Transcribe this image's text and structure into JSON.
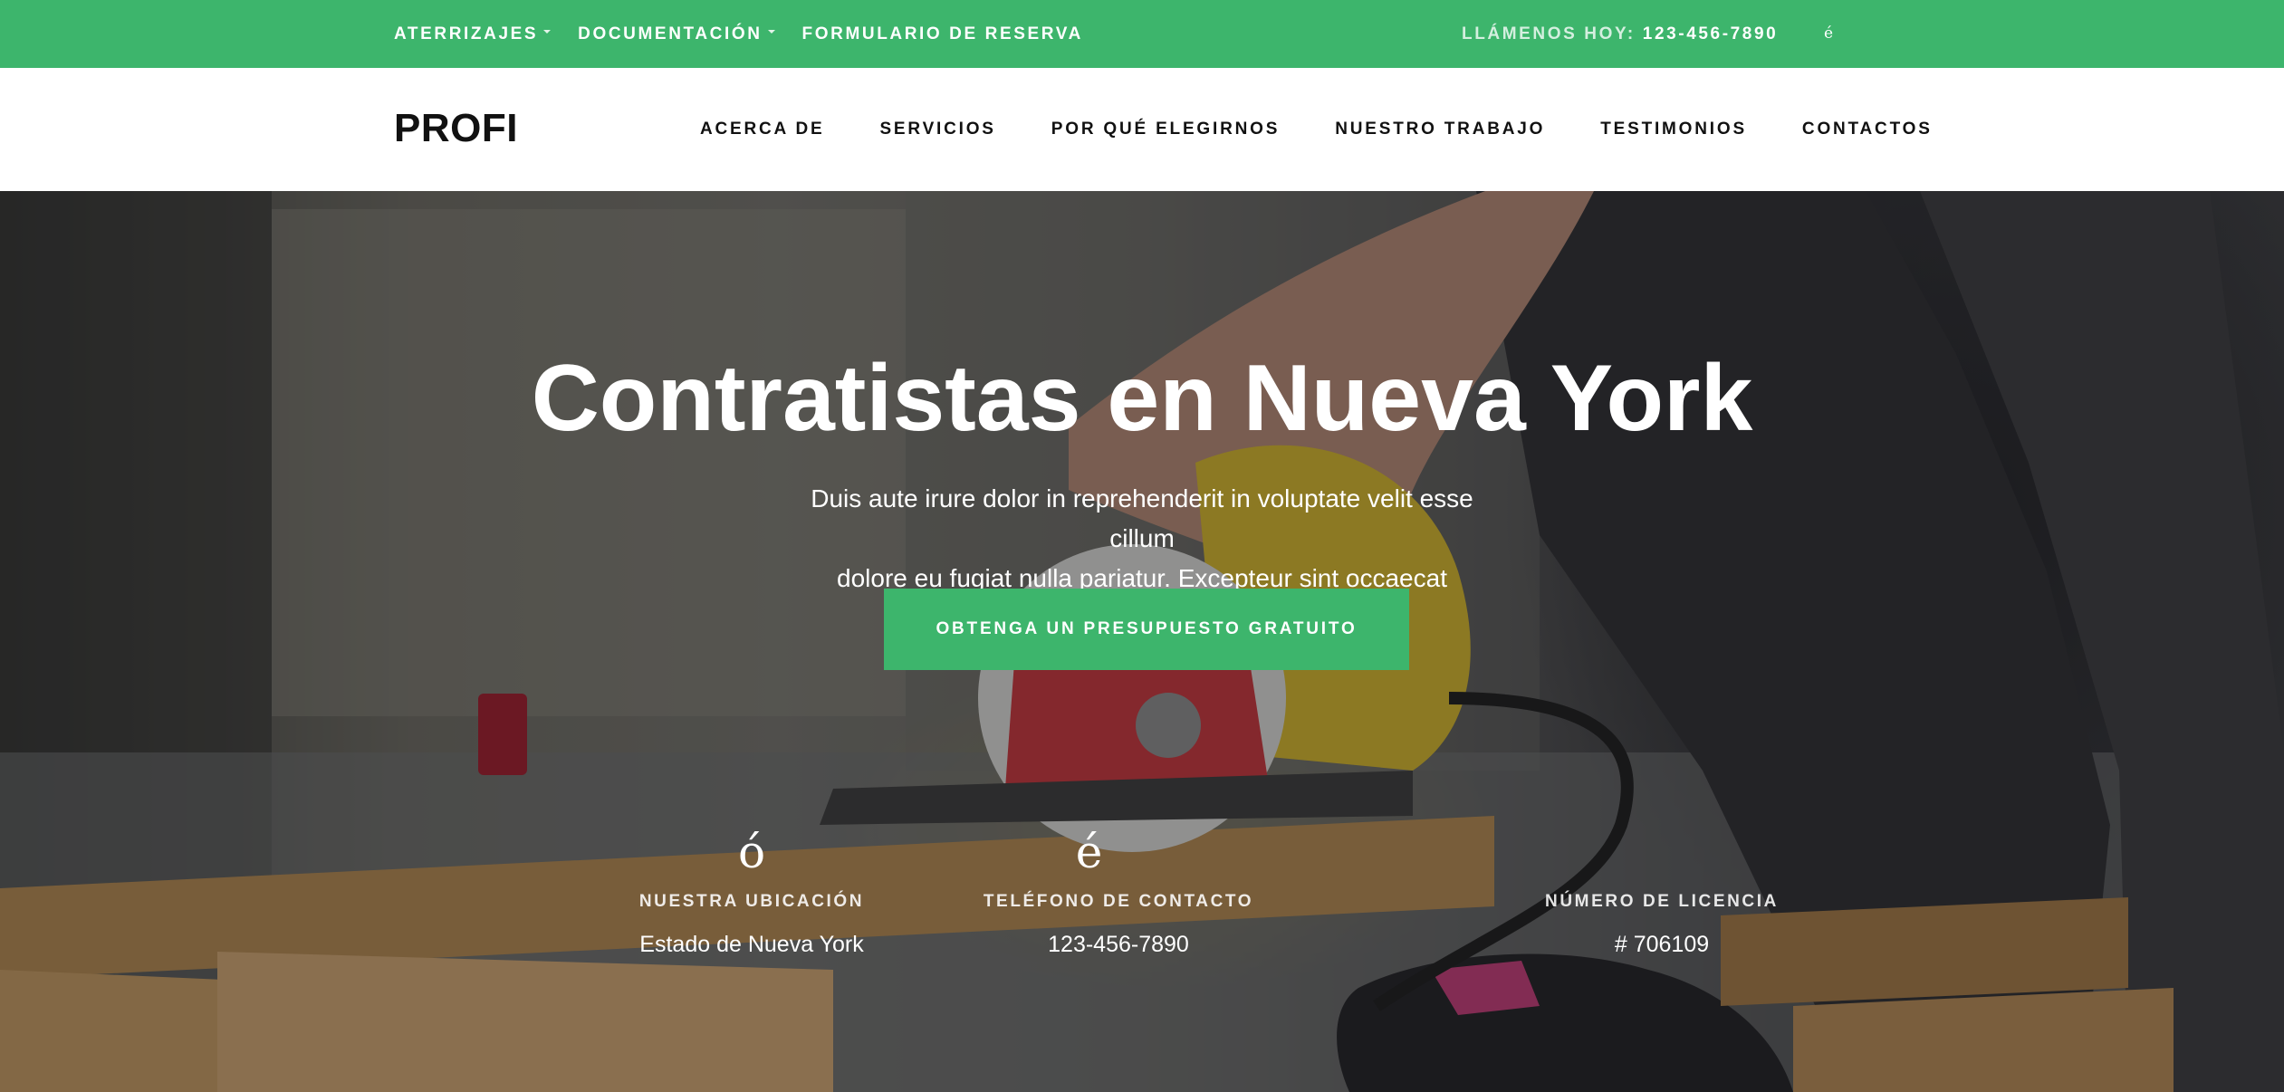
{
  "colors": {
    "accent": "#3db56c",
    "nav_background": "#ffffff",
    "text_dark": "#111111",
    "text_light": "#ffffff"
  },
  "topbar": {
    "links": [
      {
        "label": "ATERRIZAJES",
        "has_dropdown": true
      },
      {
        "label": "DOCUMENTACIÓN",
        "has_dropdown": true
      },
      {
        "label": "FORMULARIO DE RESERVA",
        "has_dropdown": false
      }
    ],
    "call_label": "LLÁMENOS HOY:",
    "call_number": "123-456-7890",
    "icon_glyph": "é",
    "icon_name": "glyph-icon"
  },
  "navbar": {
    "brand": "PROFI",
    "items": [
      "ACERCA DE",
      "SERVICIOS",
      "POR QUÉ ELEGIRNOS",
      "NUESTRO TRABAJO",
      "TESTIMONIOS",
      "CONTACTOS"
    ]
  },
  "hero": {
    "title": "Contratistas en Nueva York",
    "subtitle_line1": "Duis aute irure dolor in reprehenderit in voluptate velit esse cillum",
    "subtitle_line2": "dolore eu fugiat nulla pariatur. Excepteur sint occaecat cupidatat.",
    "cta_label": "OBTENGA UN PRESUPUESTO GRATUITO",
    "background_image": "worker cutting wood with yellow circular saw",
    "info": [
      {
        "icon": "ó",
        "icon_name": "location-icon",
        "label": "NUESTRA UBICACIÓN",
        "value": "Estado de Nueva York"
      },
      {
        "icon": "é",
        "icon_name": "phone-icon",
        "label": "TELÉFONO DE CONTACTO",
        "value": "123-456-7890"
      },
      {
        "icon": "",
        "icon_name": "license-icon",
        "label": "NÚMERO DE LICENCIA",
        "value": "# 706109"
      }
    ]
  }
}
